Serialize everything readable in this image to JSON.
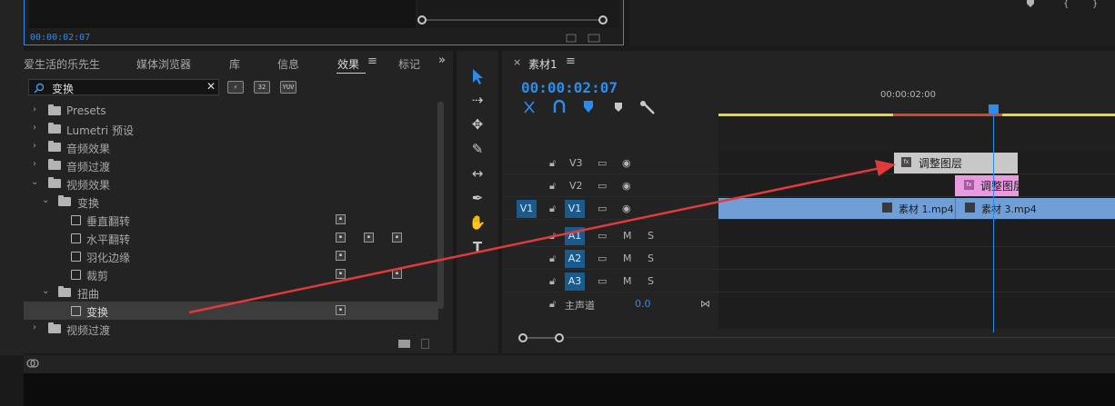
{
  "source_monitor": {
    "timecode": "00:00:02:07"
  },
  "effects_panel": {
    "tabs": [
      {
        "label": "爱生活的乐先生"
      },
      {
        "label": "媒体浏览器"
      },
      {
        "label": "库"
      },
      {
        "label": "信息"
      },
      {
        "label": "效果"
      },
      {
        "label": "标记"
      }
    ],
    "search_value": "变换",
    "badges": [
      "32",
      "32",
      "YUV"
    ],
    "tree": [
      {
        "label": "Presets"
      },
      {
        "label": "Lumetri 预设"
      },
      {
        "label": "音频效果"
      },
      {
        "label": "音频过渡"
      },
      {
        "label": "视频效果"
      },
      {
        "label": "变换"
      },
      {
        "label": "垂直翻转"
      },
      {
        "label": "水平翻转"
      },
      {
        "label": "羽化边缘"
      },
      {
        "label": "裁剪"
      },
      {
        "label": "扭曲"
      },
      {
        "label": "变换"
      },
      {
        "label": "视频过渡"
      }
    ]
  },
  "timeline": {
    "sequence_name": "素材1",
    "timecode": "00:00:02:07",
    "ruler_label": "00:00:02:00",
    "tracks": {
      "v3": "V3",
      "v2": "V2",
      "v1_src": "V1",
      "v1": "V1",
      "a1": "A1",
      "a2": "A2",
      "a3": "A3",
      "master": "主声道",
      "master_value": "0.0",
      "m": "M",
      "s": "S"
    },
    "clips": {
      "adj1": "调整图层",
      "adj2": "调整图层",
      "v1a": "素材 1.mp4",
      "v1b": "素材 3.mp4"
    }
  },
  "colors": {
    "accent": "#2d8ceb",
    "arrow": "#e03a3a"
  }
}
